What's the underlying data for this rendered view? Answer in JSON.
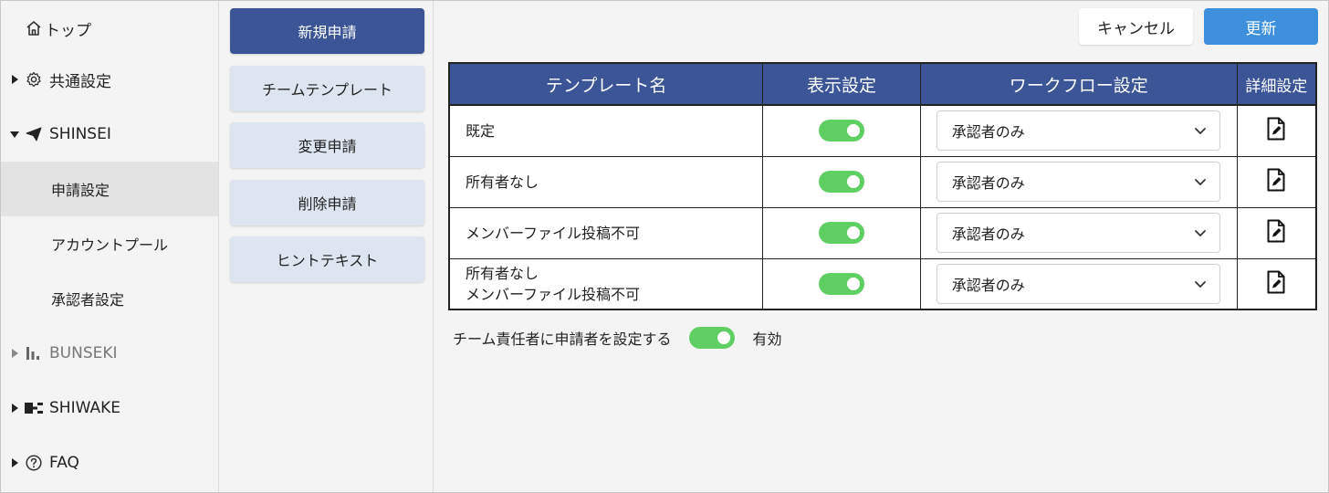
{
  "sidebar": {
    "items": [
      {
        "label": "トップ",
        "icon": "home-icon"
      },
      {
        "label": "共通設定",
        "icon": "gear-icon"
      },
      {
        "label": "SHINSEI",
        "icon": "paper-plane-icon"
      },
      {
        "label": "申請設定"
      },
      {
        "label": "アカウントプール"
      },
      {
        "label": "承認者設定"
      },
      {
        "label": "BUNSEKI",
        "icon": "bar-chart-icon"
      },
      {
        "label": "SHIWAKE",
        "icon": "split-icon"
      },
      {
        "label": "FAQ",
        "icon": "question-circle-icon"
      }
    ]
  },
  "submenu": {
    "items": [
      {
        "label": "新規申請"
      },
      {
        "label": "チームテンプレート"
      },
      {
        "label": "変更申請"
      },
      {
        "label": "削除申請"
      },
      {
        "label": "ヒントテキスト"
      }
    ]
  },
  "toolbar": {
    "cancel_label": "キャンセル",
    "update_label": "更新"
  },
  "table": {
    "headers": [
      "テンプレート名",
      "表示設定",
      "ワークフロー設定",
      "詳細設定"
    ],
    "rows": [
      {
        "name_lines": [
          "既定"
        ],
        "visible": true,
        "workflow": "承認者のみ"
      },
      {
        "name_lines": [
          "所有者なし"
        ],
        "visible": true,
        "workflow": "承認者のみ"
      },
      {
        "name_lines": [
          "メンバーファイル投稿不可"
        ],
        "visible": true,
        "workflow": "承認者のみ"
      },
      {
        "name_lines": [
          "所有者なし",
          "メンバーファイル投稿不可"
        ],
        "visible": true,
        "workflow": "承認者のみ"
      }
    ]
  },
  "footer": {
    "label": "チーム責任者に申請者を設定する",
    "toggle_on": true,
    "status": "有効"
  },
  "colors": {
    "primary": "#3b5597",
    "accent": "#3e8fdc",
    "toggle_on": "#5fcf63",
    "submenu_bg": "#dde5f0"
  }
}
